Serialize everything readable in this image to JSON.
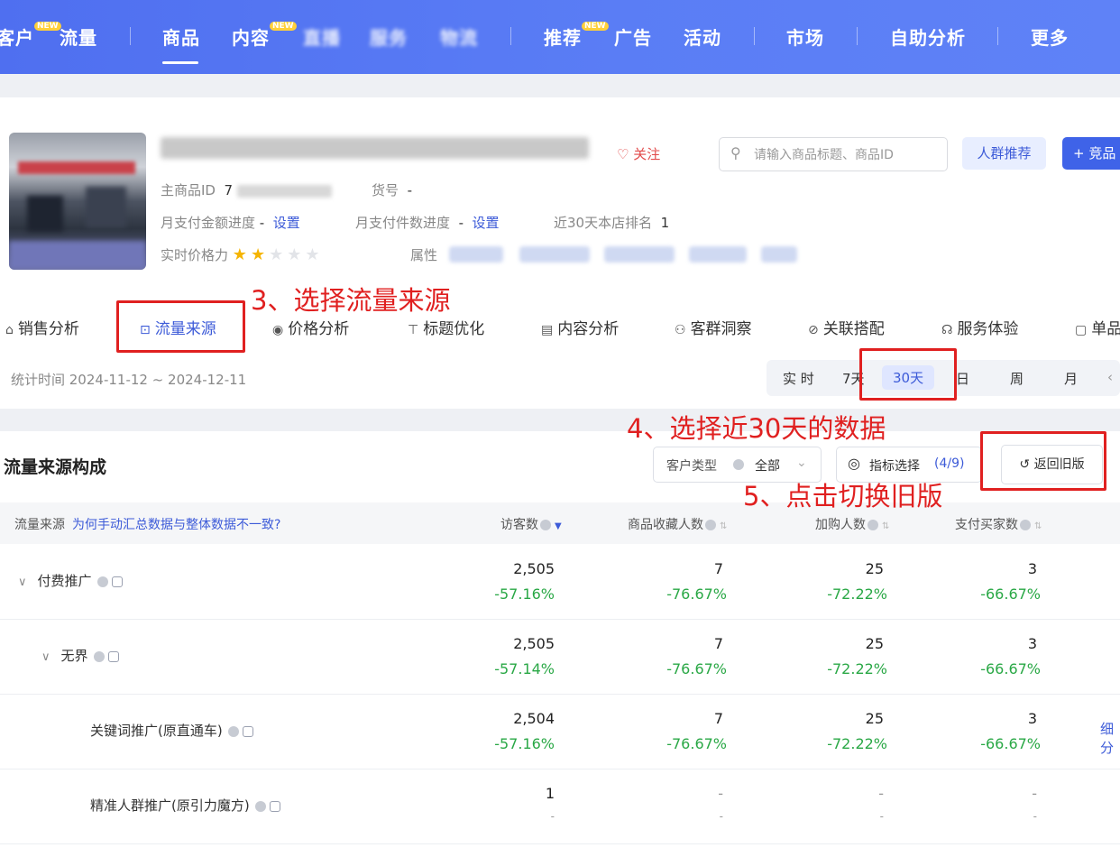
{
  "topnav": {
    "items": [
      "客户",
      "流量",
      "商品",
      "内容",
      "直播",
      "服务",
      "物流",
      "推荐",
      "广告",
      "活动",
      "市场",
      "自助分析",
      "更多"
    ],
    "new_tag": "NEW"
  },
  "product": {
    "follow": "关注",
    "search_placeholder": "请输入商品标题、商品ID",
    "crowd_btn": "人群推荐",
    "compete_btn": "+ 竞品",
    "main_id_label": "主商品ID",
    "main_id_value": "7",
    "sku_label": "货号",
    "sku_value": "-",
    "pay_amount_label": "月支付金额进度",
    "pay_amount_value": "-",
    "pay_amount_link": "设置",
    "pay_count_label": "月支付件数进度",
    "pay_count_value": "-",
    "pay_count_link": "设置",
    "rank_label": "近30天本店排名",
    "rank_value": "1",
    "price_label": "实时价格力",
    "price_stars": 2,
    "attr_label": "属性"
  },
  "tabs": [
    "销售分析",
    "流量来源",
    "价格分析",
    "标题优化",
    "内容分析",
    "客群洞察",
    "关联搭配",
    "服务体验",
    "单品"
  ],
  "period": {
    "stat_time": "统计时间 2024-11-12 ~ 2024-12-11",
    "buttons": [
      "实 时",
      "7天",
      "30天",
      "日",
      "周",
      "月"
    ],
    "active": "30天"
  },
  "panel": {
    "title": "流量来源构成",
    "cust_type_label": "客户类型",
    "cust_type_value": "全部",
    "metric_btn": "指标选择",
    "metric_count": "(4/9)",
    "back_btn": "返回旧版",
    "columns": {
      "source": "流量来源",
      "source_link": "为何手动汇总数据与整体数据不一致?",
      "visitors": "访客数",
      "favorites": "商品收藏人数",
      "carts": "加购人数",
      "buyers": "支付买家数"
    },
    "rows": [
      {
        "name": "付费推广",
        "values": [
          "2,505",
          "7",
          "25",
          "3"
        ],
        "changes": [
          "-57.16%",
          "-76.67%",
          "-72.22%",
          "-66.67%"
        ]
      },
      {
        "name": "无界",
        "values": [
          "2,505",
          "7",
          "25",
          "3"
        ],
        "changes": [
          "-57.14%",
          "-76.67%",
          "-72.22%",
          "-66.67%"
        ]
      },
      {
        "name": "关键词推广(原直通车)",
        "values": [
          "2,504",
          "7",
          "25",
          "3"
        ],
        "changes": [
          "-57.16%",
          "-76.67%",
          "-72.22%",
          "-66.67%"
        ],
        "detail": "细分"
      },
      {
        "name": "精准人群推广(原引力魔方)",
        "values": [
          "1",
          "-",
          "-",
          "-"
        ],
        "changes": [
          "-",
          "-",
          "-",
          "-"
        ]
      }
    ]
  },
  "annotations": {
    "step3": "3、选择流量来源",
    "step4": "4、选择近30天的数据",
    "step5": "5、点击切换旧版"
  },
  "colors": {
    "nav": "#5a7df5",
    "accent": "#3d5bd8",
    "decline": "#2aa846",
    "annotation": "#e02020"
  }
}
